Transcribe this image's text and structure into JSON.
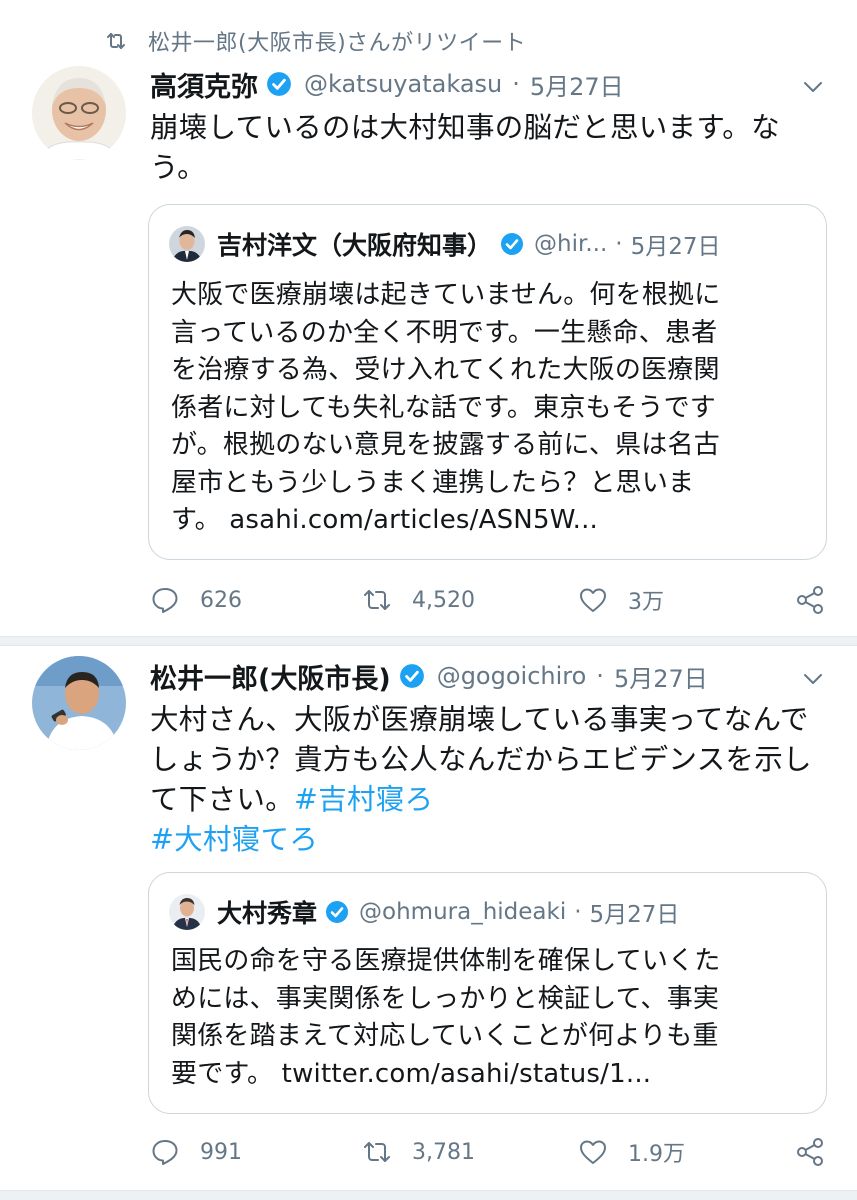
{
  "retweet_context": {
    "icon": "retweet-icon",
    "text": "松井一郎(大阪市長)さんがリツイート"
  },
  "tweets": [
    {
      "author": {
        "name": "高須克弥",
        "handle": "@katsuyatakasu",
        "verified": true
      },
      "separator": "·",
      "date": "5月27日",
      "text_lines": [
        "崩壊しているのは大村知事の脳だと思います。な",
        "う。"
      ],
      "quote": {
        "author": {
          "name": "吉村洋文（大阪府知事）",
          "handle": "@hir...",
          "verified": true
        },
        "separator": "·",
        "date": "5月27日",
        "text_lines": [
          "大阪で医療崩壊は起きていません。何を根拠に",
          "言っているのか全く不明です。一生懸命、患者",
          "を治療する為、受け入れてくれた大阪の医療関",
          "係者に対しても失礼な話です。東京もそうです",
          "が。根拠のない意見を披露する前に、県は名古",
          "屋市ともう少しうまく連携したら？と思いま",
          "す。"
        ],
        "link": "asahi.com/articles/ASN5W..."
      },
      "stats": {
        "replies": "626",
        "retweets": "4,520",
        "likes": "3万"
      }
    },
    {
      "author": {
        "name": "松井一郎(大阪市長)",
        "handle": "@gogoichiro",
        "verified": true
      },
      "separator": "·",
      "date": "5月27日",
      "text_lines": [
        "大村さん、大阪が医療崩壊している事実ってなんで",
        "しょうか？貴方も公人なんだからエビデンスを示し",
        "て下さい。"
      ],
      "hashtags": [
        "#吉村寝ろ",
        "#大村寝てろ"
      ],
      "quote": {
        "author": {
          "name": "大村秀章",
          "handle": "@ohmura_hideaki",
          "verified": true
        },
        "separator": "·",
        "date": "5月27日",
        "text_lines": [
          "国民の命を守る医療提供体制を確保していくた",
          "めには、事実関係をしっかりと検証して、事実",
          "関係を踏まえて対応していくことが何よりも重",
          "要です。"
        ],
        "link": "twitter.com/asahi/status/1..."
      },
      "stats": {
        "replies": "991",
        "retweets": "3,781",
        "likes": "1.9万"
      }
    }
  ],
  "colors": {
    "text": "#14171a",
    "secondary": "#657786",
    "accent": "#1da1f2",
    "border": "#ccd6dd"
  }
}
